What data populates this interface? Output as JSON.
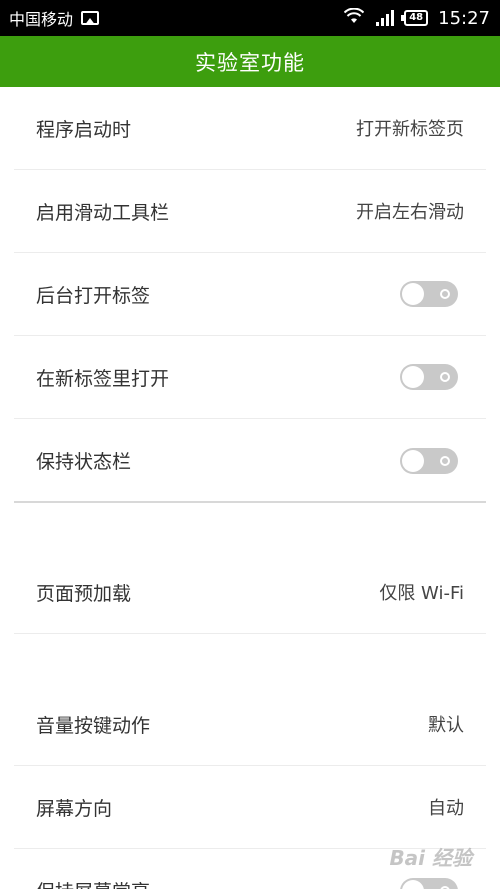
{
  "status_bar": {
    "carrier": "中国移动",
    "battery": "48",
    "time": "15:27"
  },
  "header": {
    "title": "实验室功能"
  },
  "settings": {
    "startup": {
      "label": "程序启动时",
      "value": "打开新标签页"
    },
    "slide_toolbar": {
      "label": "启用滑动工具栏",
      "value": "开启左右滑动"
    },
    "background_tab": {
      "label": "后台打开标签",
      "toggle_on": false
    },
    "open_new_tab": {
      "label": "在新标签里打开",
      "toggle_on": false
    },
    "keep_status_bar": {
      "label": "保持状态栏",
      "toggle_on": false
    },
    "preload": {
      "label": "页面预加载",
      "value": "仅限 Wi-Fi"
    },
    "volume_keys": {
      "label": "音量按键动作",
      "value": "默认"
    },
    "orientation": {
      "label": "屏幕方向",
      "value": "自动"
    },
    "keep_screen_on": {
      "label": "保持屏幕常亮",
      "toggle_on": false
    }
  },
  "watermark": "Bai 经验",
  "colors": {
    "header_green": "#3d9e0e",
    "toggle_off": "#c9c9c9"
  }
}
